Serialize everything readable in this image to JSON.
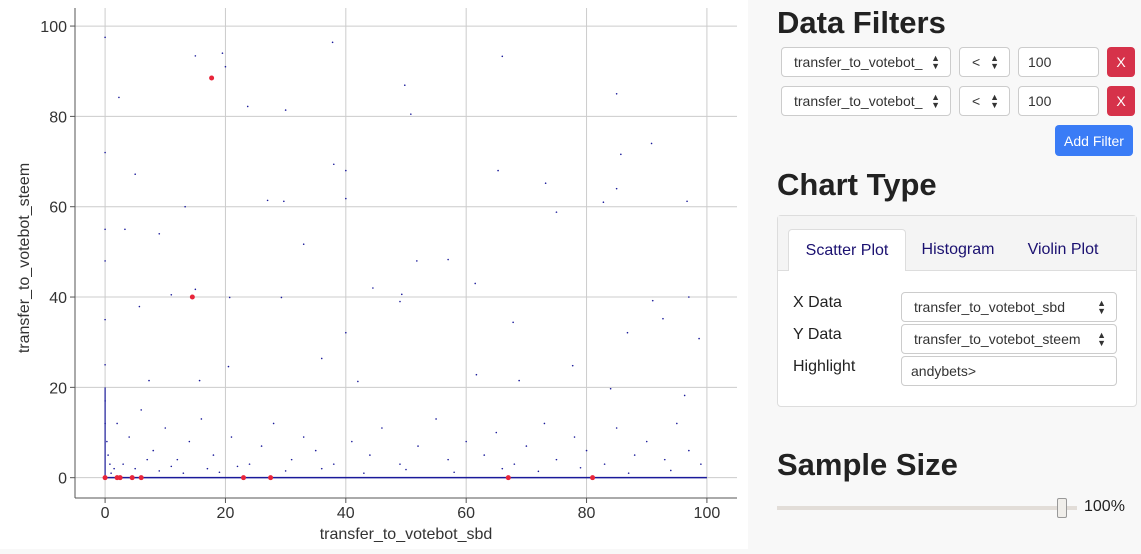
{
  "chart_data": {
    "type": "scatter",
    "xlabel": "transfer_to_votebot_sbd",
    "ylabel": "transfer_to_votebot_steem",
    "xlim": [
      -5,
      105
    ],
    "ylim": [
      -4.5,
      104
    ],
    "xticks": [
      0,
      20,
      40,
      60,
      80,
      100
    ],
    "yticks": [
      0,
      20,
      40,
      60,
      80,
      100
    ],
    "grid": true,
    "colors": {
      "points": "#1a1a9a",
      "highlight": "#e8253a",
      "grid": "#cccccc"
    },
    "points": [
      [
        0,
        97.5
      ],
      [
        0,
        72
      ],
      [
        0,
        55
      ],
      [
        0,
        48
      ],
      [
        0,
        35
      ],
      [
        0,
        25
      ],
      [
        0,
        17
      ],
      [
        0,
        12
      ],
      [
        0.3,
        8
      ],
      [
        0.5,
        5
      ],
      [
        15,
        93.4
      ],
      [
        19.5,
        94
      ],
      [
        20,
        91
      ],
      [
        37.8,
        96.4
      ],
      [
        66,
        93.3
      ],
      [
        49.8,
        86.9
      ],
      [
        85,
        85
      ],
      [
        2.3,
        84.2
      ],
      [
        23.7,
        82.2
      ],
      [
        30,
        81.4
      ],
      [
        50.8,
        80.5
      ],
      [
        85.7,
        71.6
      ],
      [
        90.8,
        74
      ],
      [
        38,
        69.4
      ],
      [
        40,
        68
      ],
      [
        65.3,
        68
      ],
      [
        73.2,
        65.2
      ],
      [
        5,
        67.2
      ],
      [
        13.3,
        60
      ],
      [
        27,
        61.4
      ],
      [
        29.7,
        61.2
      ],
      [
        40,
        61.8
      ],
      [
        75,
        58.8
      ],
      [
        82.8,
        61
      ],
      [
        85,
        64
      ],
      [
        96.7,
        61.2
      ],
      [
        3.3,
        55
      ],
      [
        9,
        54
      ],
      [
        33,
        51.7
      ],
      [
        51.8,
        48
      ],
      [
        57,
        48.3
      ],
      [
        20.7,
        39.9
      ],
      [
        29.3,
        39.9
      ],
      [
        49.3,
        40.6
      ],
      [
        91,
        39.2
      ],
      [
        92.7,
        35.2
      ],
      [
        97,
        40
      ],
      [
        98.7,
        30.8
      ],
      [
        86.8,
        32.1
      ],
      [
        67.8,
        34.4
      ],
      [
        40,
        32.1
      ],
      [
        44.5,
        42
      ],
      [
        49,
        39
      ],
      [
        61.5,
        43
      ],
      [
        36,
        26.4
      ],
      [
        15,
        41.7
      ],
      [
        11,
        40.5
      ],
      [
        5.7,
        37.9
      ],
      [
        20.5,
        24.6
      ],
      [
        42,
        21.3
      ],
      [
        77.7,
        24.8
      ],
      [
        61.7,
        22.8
      ],
      [
        68.8,
        21.5
      ],
      [
        15.7,
        21.5
      ],
      [
        7.3,
        21.5
      ],
      [
        84,
        19.7
      ],
      [
        96.3,
        18.2
      ],
      [
        2,
        12
      ],
      [
        4,
        9
      ],
      [
        6,
        15
      ],
      [
        8,
        6
      ],
      [
        10,
        11
      ],
      [
        12,
        4
      ],
      [
        14,
        8
      ],
      [
        16,
        13
      ],
      [
        18,
        5
      ],
      [
        21,
        9
      ],
      [
        24,
        3
      ],
      [
        26,
        7
      ],
      [
        28,
        12
      ],
      [
        31,
        4
      ],
      [
        33,
        9
      ],
      [
        35,
        6
      ],
      [
        38,
        3
      ],
      [
        41,
        8
      ],
      [
        44,
        5
      ],
      [
        46,
        11
      ],
      [
        49,
        3
      ],
      [
        52,
        7
      ],
      [
        55,
        13
      ],
      [
        57,
        4
      ],
      [
        60,
        8
      ],
      [
        63,
        5
      ],
      [
        65,
        10
      ],
      [
        68,
        3
      ],
      [
        70,
        7
      ],
      [
        73,
        12
      ],
      [
        75,
        4
      ],
      [
        78,
        9
      ],
      [
        80,
        6
      ],
      [
        83,
        3
      ],
      [
        85,
        11
      ],
      [
        88,
        5
      ],
      [
        90,
        8
      ],
      [
        93,
        4
      ],
      [
        95,
        12
      ],
      [
        97,
        6
      ],
      [
        99,
        3
      ],
      [
        3,
        3
      ],
      [
        5,
        2
      ],
      [
        7,
        4
      ],
      [
        9,
        1.5
      ],
      [
        11,
        2.5
      ],
      [
        13,
        1
      ],
      [
        17,
        2
      ],
      [
        19,
        1.2
      ],
      [
        22,
        2.5
      ],
      [
        30,
        1.5
      ],
      [
        36,
        2
      ],
      [
        43,
        1
      ],
      [
        50,
        1.8
      ],
      [
        58,
        1.2
      ],
      [
        66,
        2
      ],
      [
        72,
        1.4
      ],
      [
        79,
        2.2
      ],
      [
        87,
        1
      ],
      [
        94,
        1.6
      ],
      [
        1,
        1
      ],
      [
        1.5,
        2
      ],
      [
        0.8,
        3
      ]
    ],
    "highlight_points": [
      [
        17.7,
        88.5
      ],
      [
        14.5,
        40
      ],
      [
        0,
        0
      ],
      [
        2,
        0
      ],
      [
        2.5,
        0
      ],
      [
        4.5,
        0
      ],
      [
        6,
        0
      ],
      [
        23,
        0
      ],
      [
        27.5,
        0
      ],
      [
        67,
        0
      ],
      [
        81,
        0
      ]
    ]
  },
  "filters": {
    "title": "Data Filters",
    "items": [
      {
        "field": "transfer_to_votebot_",
        "op": "<",
        "value": "100",
        "remove": "X"
      },
      {
        "field": "transfer_to_votebot_",
        "op": "<",
        "value": "100",
        "remove": "X"
      }
    ],
    "add_label": "Add Filter"
  },
  "chart_type": {
    "title": "Chart Type",
    "tabs": [
      "Scatter Plot",
      "Histogram",
      "Violin Plot"
    ],
    "active_tab": "Scatter Plot",
    "x_label": "X Data",
    "x_value": "transfer_to_votebot_sbd",
    "y_label": "Y Data",
    "y_value": "transfer_to_votebot_steem",
    "highlight_label": "Highlight",
    "highlight_value": "andybets>"
  },
  "sample": {
    "title": "Sample Size",
    "value_label": "100%",
    "value_percent": 100
  }
}
